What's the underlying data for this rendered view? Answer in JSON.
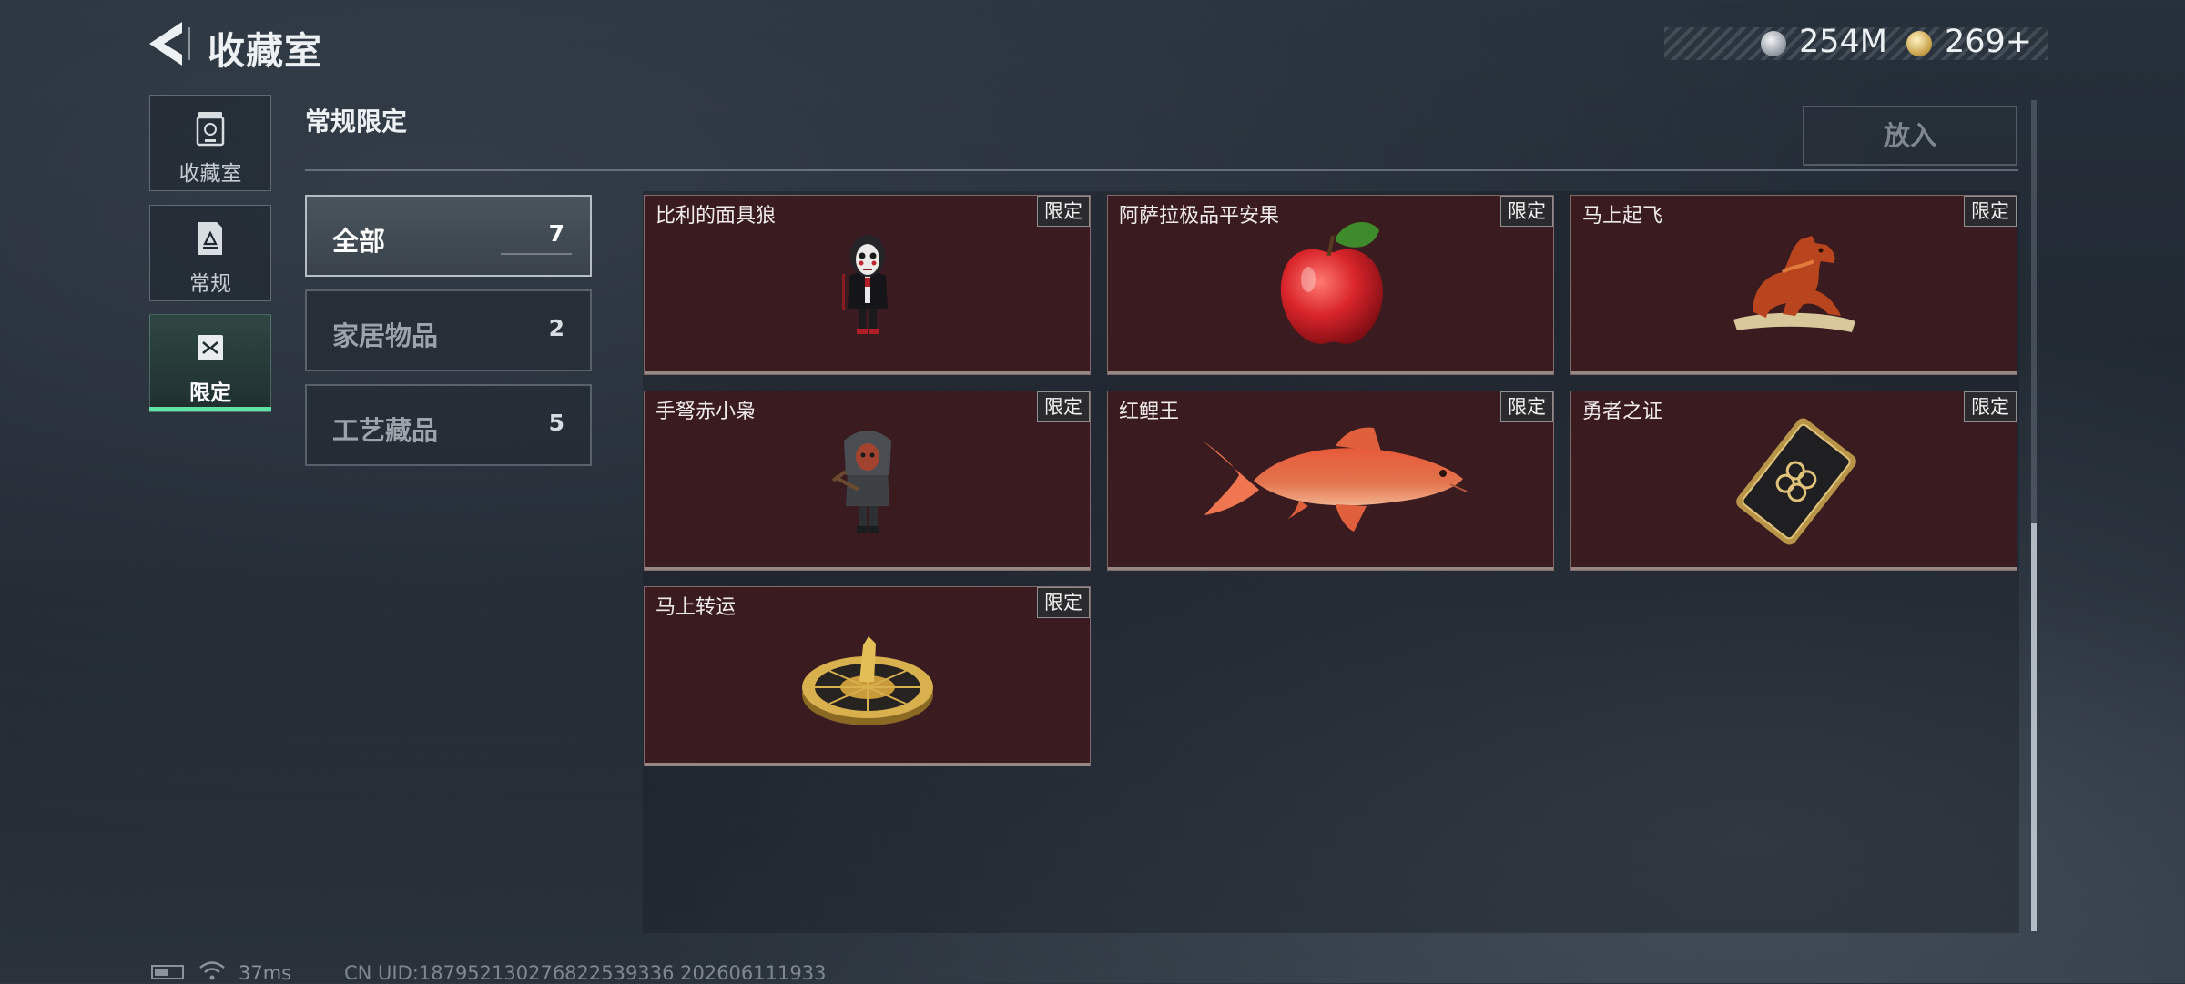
{
  "header": {
    "title": "收藏室",
    "currencies": [
      {
        "name": "silver-coin",
        "value": "254M",
        "color": "#c9cfd5"
      },
      {
        "name": "gold-coin",
        "value": "269+",
        "color": "#c9a24a"
      }
    ]
  },
  "nav": {
    "items": [
      {
        "label": "收藏室",
        "icon": "vault-icon"
      },
      {
        "label": "常规",
        "icon": "document-icon"
      },
      {
        "label": "限定",
        "icon": "limited-icon",
        "active": true
      }
    ],
    "accent": "#5fe3a6"
  },
  "section": {
    "title": "常规限定",
    "place_button": "放入"
  },
  "categories": [
    {
      "label": "全部",
      "count": "7",
      "selected": true
    },
    {
      "label": "家居物品",
      "count": "2"
    },
    {
      "label": "工艺藏品",
      "count": "5"
    }
  ],
  "items": [
    {
      "name": "比利的面具狼",
      "badge": "限定",
      "icon": "masked-figure-icon"
    },
    {
      "name": "阿萨拉极品平安果",
      "badge": "限定",
      "icon": "apple-icon"
    },
    {
      "name": "马上起飞",
      "badge": "限定",
      "icon": "horse-statue-icon"
    },
    {
      "name": "手弩赤小枭",
      "badge": "限定",
      "icon": "hooded-figure-icon"
    },
    {
      "name": "红鲤王",
      "badge": "限定",
      "icon": "koi-fish-icon"
    },
    {
      "name": "勇者之证",
      "badge": "限定",
      "icon": "gold-card-icon"
    },
    {
      "name": "马上转运",
      "badge": "限定",
      "icon": "golden-wheel-icon"
    }
  ],
  "card_color": "#3a1b1f",
  "status": {
    "ping": "37ms",
    "uid": "CN UID:187952130276822539336 202606111933"
  }
}
